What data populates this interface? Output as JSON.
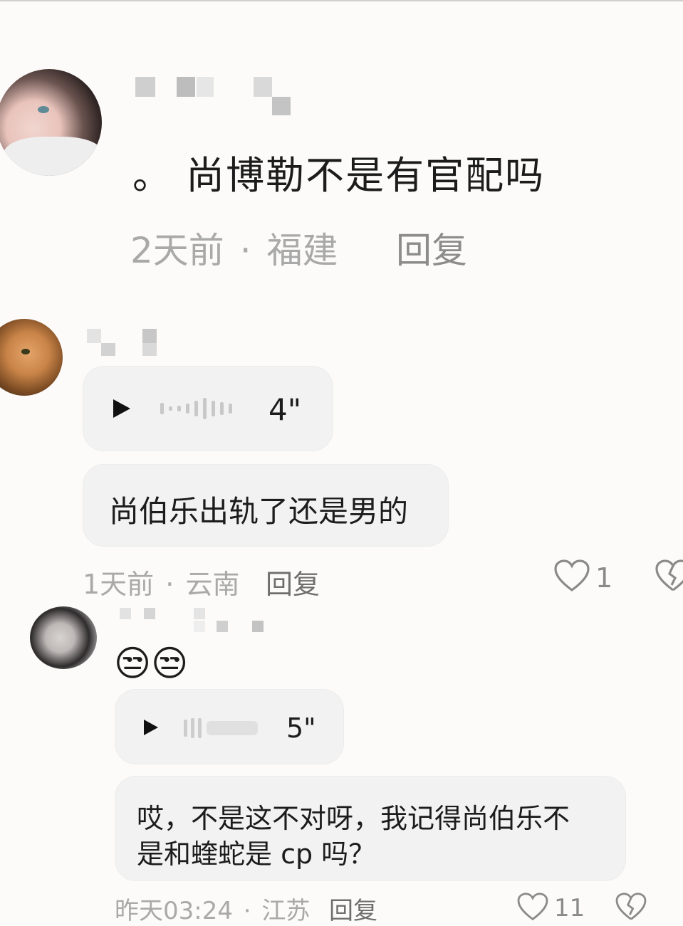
{
  "comment1": {
    "text": "。 尚博勒不是有官配吗",
    "time": "2天前",
    "dot": "·",
    "location": "福建",
    "reply": "回复"
  },
  "comment2": {
    "voice_duration": "4\"",
    "text": "尚伯乐出轨了还是男的",
    "time": "1天前",
    "dot": "·",
    "location": "云南",
    "reply": "回复",
    "likes": "1"
  },
  "comment3": {
    "emojis": [
      "😒",
      "😒"
    ],
    "voice_duration": "5\"",
    "text_line1": "哎，不是这不对呀，我记得尚伯乐不",
    "text_line2": "是和蝰蛇是 cp 吗？",
    "time": "昨天03:24",
    "dot": "·",
    "location": "江苏",
    "reply": "回复",
    "likes": "11"
  },
  "icons": {
    "play": "play-icon",
    "like": "heart-icon",
    "dislike": "broken-heart-icon"
  }
}
